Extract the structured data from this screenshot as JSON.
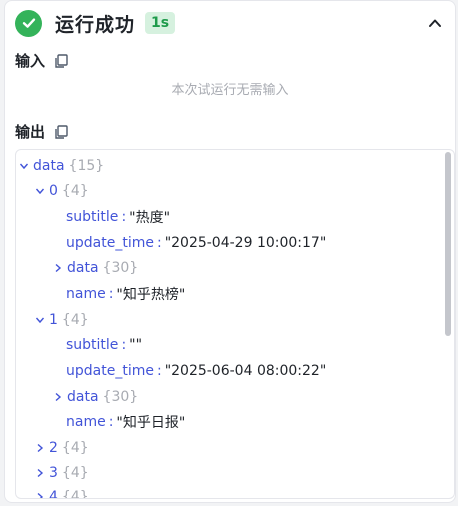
{
  "header": {
    "title": "运行成功",
    "duration": "1s"
  },
  "input": {
    "label": "输入",
    "empty_text": "本次试运行无需输入"
  },
  "output": {
    "label": "输出",
    "root": {
      "key": "data",
      "count": "{15}"
    },
    "item0": {
      "key": "0",
      "count": "{4}"
    },
    "item0_subtitle": {
      "key": "subtitle",
      "value": "\"热度\""
    },
    "item0_update": {
      "key": "update_time",
      "value": "\"2025-04-29 10:00:17\""
    },
    "item0_data": {
      "key": "data",
      "count": "{30}"
    },
    "item0_name": {
      "key": "name",
      "value": "\"知乎热榜\""
    },
    "item1": {
      "key": "1",
      "count": "{4}"
    },
    "item1_subtitle": {
      "key": "subtitle",
      "value": "\"\""
    },
    "item1_update": {
      "key": "update_time",
      "value": "\"2025-06-04 08:00:22\""
    },
    "item1_data": {
      "key": "data",
      "count": "{30}"
    },
    "item1_name": {
      "key": "name",
      "value": "\"知乎日报\""
    },
    "item2": {
      "key": "2",
      "count": "{4}"
    },
    "item3": {
      "key": "3",
      "count": "{4}"
    },
    "item4": {
      "key": "4",
      "count": "{4}"
    }
  },
  "colors": {
    "success": "#34b35a",
    "key": "#4254d8",
    "muted": "#a8abb2"
  }
}
